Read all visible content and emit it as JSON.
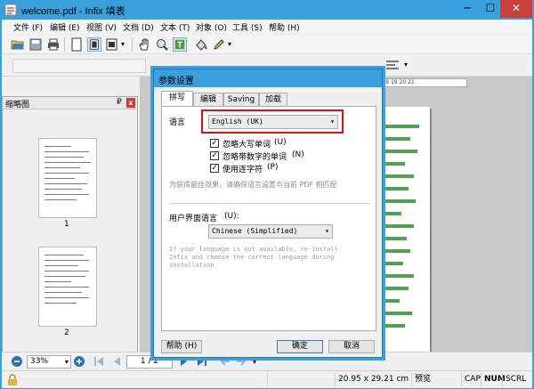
{
  "window": {
    "title": "welcome.pdf - Infix 填表",
    "minimize": "─",
    "maximize": "☐",
    "close": "✕"
  },
  "menu": [
    "文件 (F)",
    "编辑 (E)",
    "视图 (V)",
    "文档 (D)",
    "文本 (T)",
    "对象 (O)",
    "工具 (S)",
    "帮助 (H)"
  ],
  "thumbnails": {
    "title": "缩略图",
    "pin": "₽",
    "close": "x",
    "pages": [
      "1",
      "2"
    ]
  },
  "dialog": {
    "title": "参数设置",
    "tabs": [
      "拼写",
      "编辑",
      "Saving",
      "加载"
    ],
    "language_label": "语言",
    "language_value": "English (UK)",
    "options": [
      {
        "label": "忽略大写单词",
        "key": "(U)",
        "checked": true
      },
      {
        "label": "忽略带数字的单词",
        "key": "(N)",
        "checked": true
      },
      {
        "label": "使用连字符",
        "key": "(P)",
        "checked": true
      }
    ],
    "hint": "为获得最佳效果，请确保语言设置与当前 PDF 相匹配",
    "ui_language_label": "用户界面语言",
    "ui_language_key": "(U):",
    "ui_language_value": "Chinese (Simplified)",
    "ui_hint": "If your language is not available, re-install\nInfix and choose the correct language during\ninstallation.",
    "help_button": "帮助 (H)",
    "ok_button": "确定",
    "cancel_button": "取消"
  },
  "navigation": {
    "zoom": "33%",
    "page": "1 / 2"
  },
  "status": {
    "page_size": "20.95 x 29.21 cm",
    "mode": "预览",
    "caps": "CAP",
    "num": "NUM",
    "scroll": "SCRL"
  },
  "colors": {
    "titlebar": "#3aa0dc",
    "highlight_box": "#e01010",
    "close_button": "#c7413a"
  }
}
